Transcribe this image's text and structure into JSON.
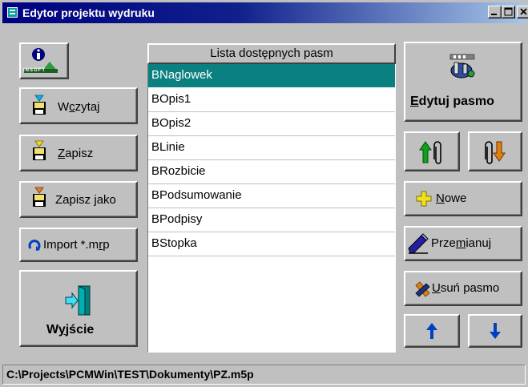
{
  "window": {
    "title": "Edytor projektu wydruku"
  },
  "left_buttons": {
    "info_logo_text": "INSOFT",
    "load": {
      "label_pre": "W",
      "label_ul": "c",
      "label_post": "zytaj"
    },
    "save": {
      "label_pre": "",
      "label_ul": "Z",
      "label_post": "apisz"
    },
    "save_as": {
      "label_pre": "Zapisz ",
      "label_ul": "j",
      "label_post": "ako"
    },
    "import": {
      "label_pre": "Import *.m",
      "label_ul": "r",
      "label_post": "p"
    },
    "exit": {
      "label_pre": "W",
      "label_ul": "y",
      "label_post": "jście"
    }
  },
  "band_list": {
    "header": "Lista dostępnych pasm",
    "items": [
      "BNaglowek",
      "BOpis1",
      "BOpis2",
      "BLinie",
      "BRozbicie",
      "BPodsumowanie",
      "BPodpisy",
      "BStopka"
    ],
    "selected_index": 0
  },
  "right_buttons": {
    "edit_band": {
      "label_pre": "",
      "label_ul": "E",
      "label_post": "dytuj pasmo"
    },
    "new": {
      "label_pre": "",
      "label_ul": "N",
      "label_post": "owe"
    },
    "rename": {
      "label_pre": "Prze",
      "label_ul": "m",
      "label_post": "ianuj"
    },
    "delete": {
      "label_pre": "",
      "label_ul": "U",
      "label_post": "suń pasmo"
    }
  },
  "status_bar": {
    "path": "C:\\Projects\\PCMWin\\TEST\\Dokumenty\\PZ.m5p"
  },
  "colors": {
    "title_start": "#000080",
    "title_end": "#a7c6e8",
    "selection": "#0a8080",
    "face": "#c0c0c0"
  }
}
